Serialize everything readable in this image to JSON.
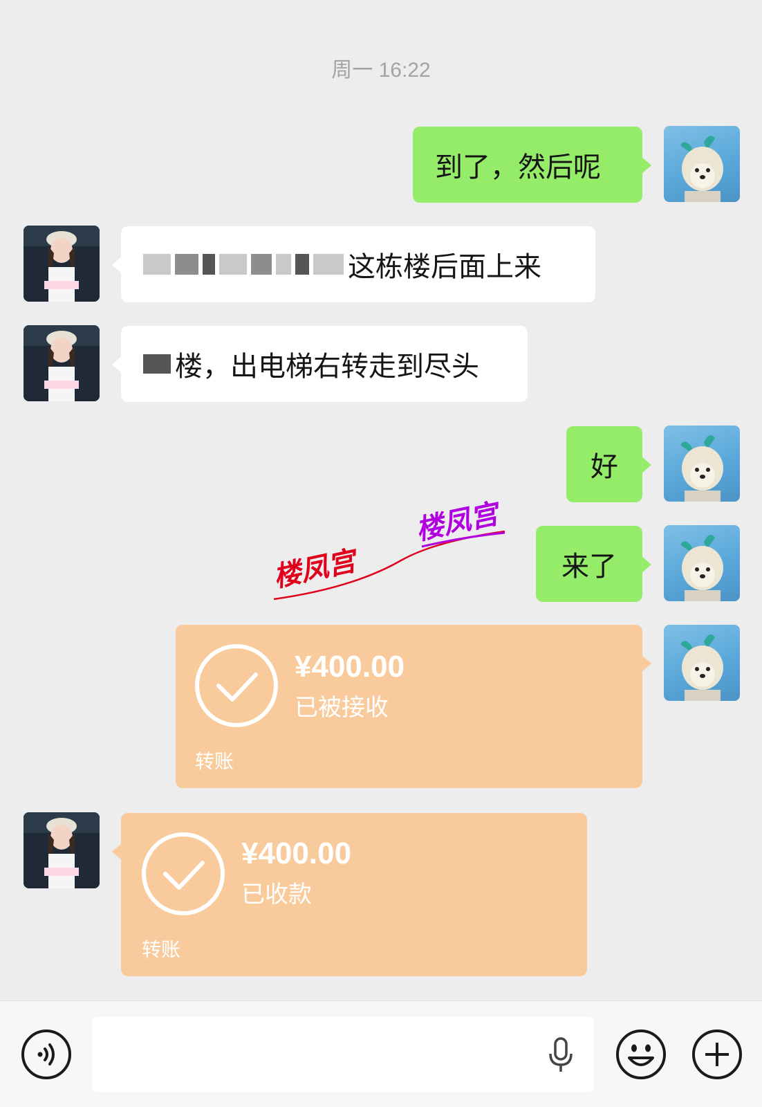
{
  "chat": {
    "timestamp": "周一 16:22",
    "messages": [
      {
        "sender": "self",
        "text": "到了，然后呢"
      },
      {
        "sender": "other",
        "text_visible": "这栋楼后面上来",
        "redacted": true
      },
      {
        "sender": "other",
        "text_visible": "楼，出电梯右转走到尽头",
        "redacted": true
      },
      {
        "sender": "self",
        "text": "好"
      },
      {
        "sender": "self",
        "text": "来了"
      }
    ],
    "transfers": [
      {
        "sender": "self",
        "amount": "¥400.00",
        "status": "已被接收",
        "label": "转账"
      },
      {
        "sender": "other",
        "amount": "¥400.00",
        "status": "已收款",
        "label": "转账"
      }
    ]
  },
  "watermarks": [
    "楼凤宫",
    "楼凤宫"
  ],
  "colors": {
    "background": "#ededed",
    "self_bubble": "#95ec69",
    "other_bubble": "#ffffff",
    "transfer_card": "#f9cb9c",
    "watermark_red": "#e0001b",
    "watermark_purple": "#b000e0"
  },
  "icons": {
    "voice": "voice-toggle-icon",
    "mic": "microphone-icon",
    "emoji": "emoji-icon",
    "plus": "plus-icon",
    "check": "check-icon"
  }
}
